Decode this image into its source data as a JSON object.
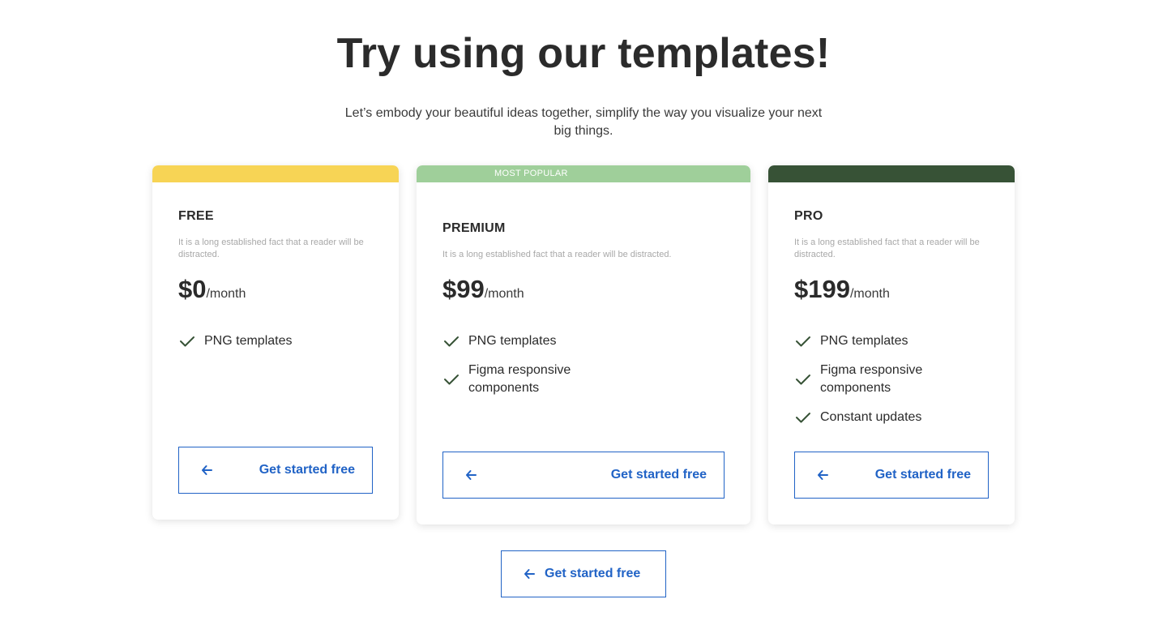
{
  "header": {
    "title": "Try using our templates!",
    "subtitle": "Let’s embody your beautiful ideas together, simplify the way you visualize your next big things."
  },
  "plans": [
    {
      "band_color": "#f7d455",
      "band_label": "",
      "name": "FREE",
      "description": "It is a long established fact that a reader will be distracted.",
      "price": "$0",
      "period": "/month",
      "features": [
        "PNG templates"
      ],
      "cta_label": "Get started free"
    },
    {
      "band_color": "#9fcf9a",
      "band_label": "MOST POPULAR",
      "name": "PREMIUM",
      "description": "It is a long established fact that a reader will be distracted.",
      "price": "$99",
      "period": "/month",
      "features": [
        "PNG templates",
        "Figma responsive components"
      ],
      "cta_label": "Get started free"
    },
    {
      "band_color": "#375236",
      "band_label": "",
      "name": "PRO",
      "description": "It is a long established fact that a reader will be distracted.",
      "price": "$199",
      "period": "/month",
      "features": [
        "PNG templates",
        "Figma responsive components",
        "Constant updates"
      ],
      "cta_label": "Get started free"
    }
  ],
  "bottom_cta": {
    "label": "Get started free"
  },
  "icons": {
    "check": "check-icon",
    "arrow": "arrow-left-icon"
  },
  "colors": {
    "accent": "#2163c6",
    "check": "#375236"
  }
}
